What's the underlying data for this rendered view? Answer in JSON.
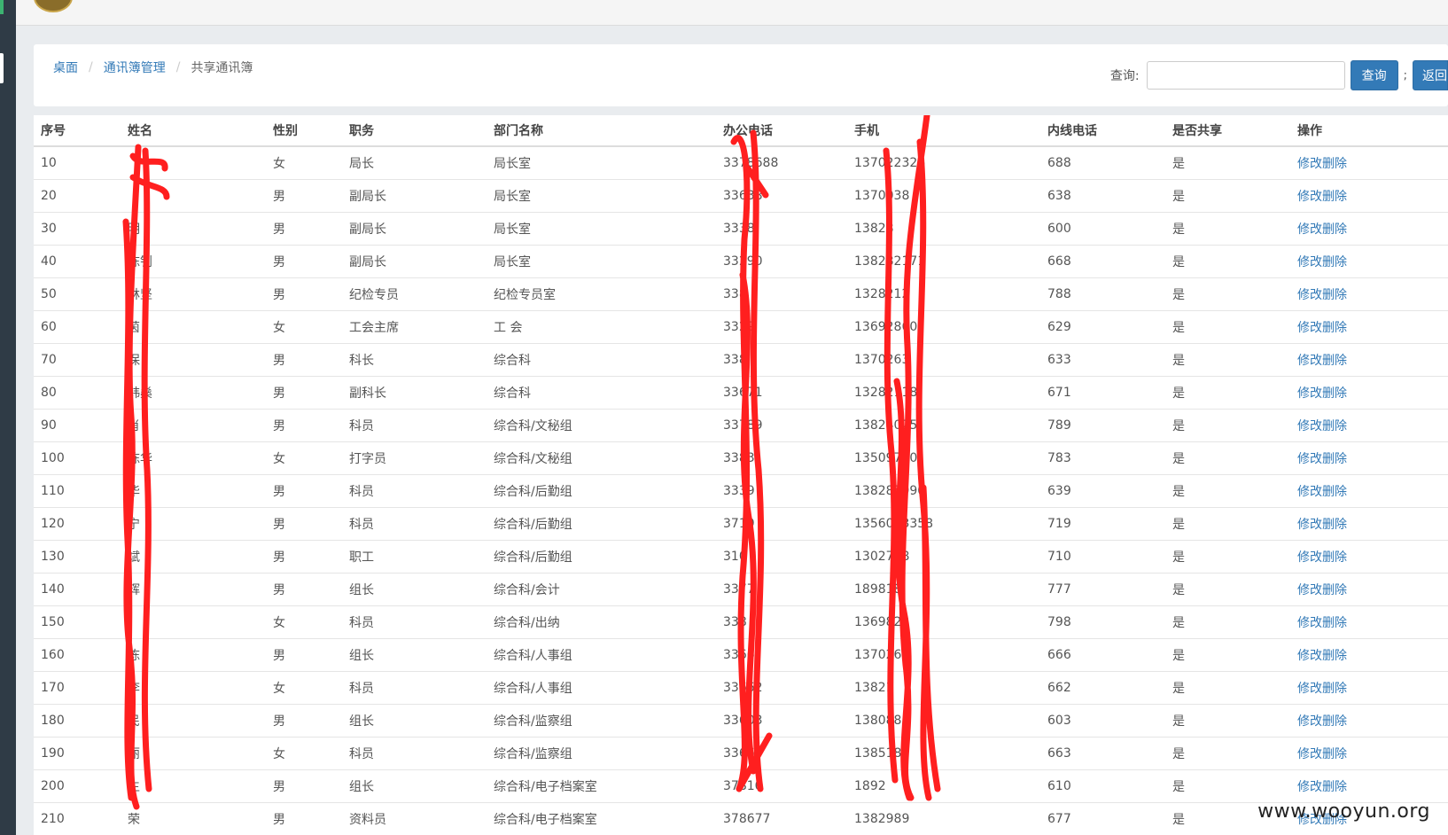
{
  "breadcrumb": {
    "home": "桌面",
    "section": "通讯簿管理",
    "current": "共享通讯簿"
  },
  "search": {
    "label": "查询:",
    "value": "",
    "button": "查询",
    "separator": ";",
    "back_button": "返回"
  },
  "table": {
    "headers": [
      "序号",
      "姓名",
      "性别",
      "职务",
      "部门名称",
      "办公电话",
      "手机",
      "内线电话",
      "是否共享",
      "操作"
    ],
    "rows": [
      [
        "10",
        "",
        "女",
        "局长",
        "局长室",
        "3378688",
        "137022326",
        "688",
        "是",
        "修改删除"
      ],
      [
        "20",
        "",
        "男",
        "副局长",
        "局长室",
        "33638",
        "1370038",
        "638",
        "是",
        "修改删除"
      ],
      [
        "30",
        "明",
        "男",
        "副局长",
        "局长室",
        "3338",
        "13828",
        "600",
        "是",
        "修改删除"
      ],
      [
        "40",
        "陈钊",
        "男",
        "副局长",
        "局长室",
        "33290",
        "138282171",
        "668",
        "是",
        "修改删除"
      ],
      [
        "50",
        "林坚",
        "男",
        "纪检专员",
        "纪检专员室",
        "338",
        "1328212",
        "788",
        "是",
        "修改删除"
      ],
      [
        "60",
        "茵",
        "女",
        "工会主席",
        "工 会",
        "3329",
        "13692860",
        "629",
        "是",
        "修改删除"
      ],
      [
        "70",
        "保",
        "男",
        "科长",
        "综合科",
        "338",
        "1370263",
        "633",
        "是",
        "修改删除"
      ],
      [
        "80",
        "韩燊",
        "男",
        "副科长",
        "综合科",
        "33671",
        "13282118",
        "671",
        "是",
        "修改删除"
      ],
      [
        "90",
        "肖",
        "男",
        "科员",
        "综合科/文秘组",
        "33789",
        "13824025",
        "789",
        "是",
        "修改删除"
      ],
      [
        "100",
        "陈华",
        "女",
        "打字员",
        "综合科/文秘组",
        "3383",
        "13509720",
        "783",
        "是",
        "修改删除"
      ],
      [
        "110",
        "华",
        "男",
        "科员",
        "综合科/后勤组",
        "3339",
        "138285990",
        "639",
        "是",
        "修改删除"
      ],
      [
        "120",
        "宁",
        "男",
        "科员",
        "综合科/后勤组",
        "3719",
        "1356033358",
        "719",
        "是",
        "修改删除"
      ],
      [
        "130",
        "斌",
        "男",
        "职工",
        "综合科/后勤组",
        "310",
        "1302738",
        "710",
        "是",
        "修改删除"
      ],
      [
        "140",
        "辉",
        "男",
        "组长",
        "综合科/会计",
        "3377",
        "189818",
        "777",
        "是",
        "修改删除"
      ],
      [
        "150",
        "",
        "女",
        "科员",
        "综合科/出纳",
        "338",
        "1369822",
        "798",
        "是",
        "修改删除"
      ],
      [
        "160",
        "陈",
        "男",
        "组长",
        "综合科/人事组",
        "3366",
        "1370267",
        "666",
        "是",
        "修改删除"
      ],
      [
        "170",
        "李",
        "女",
        "科员",
        "综合科/人事组",
        "33662",
        "13821",
        "662",
        "是",
        "修改删除"
      ],
      [
        "180",
        "民",
        "男",
        "组长",
        "综合科/监察组",
        "33603",
        "138088",
        "603",
        "是",
        "修改删除"
      ],
      [
        "190",
        "丽",
        "女",
        "科员",
        "综合科/监察组",
        "33663",
        "138518",
        "663",
        "是",
        "修改删除"
      ],
      [
        "200",
        "生",
        "男",
        "组长",
        "综合科/电子档案室",
        "37810",
        "1892",
        "610",
        "是",
        "修改删除"
      ],
      [
        "210",
        "荣",
        "男",
        "资料员",
        "综合科/电子档案室",
        "378677",
        "1382989",
        "677",
        "是",
        "修改删除"
      ]
    ]
  },
  "watermark": "www.wooyun.org",
  "colors": {
    "link": "#337ab7",
    "button": "#337ab7",
    "scribble": "#ff1f1f"
  }
}
